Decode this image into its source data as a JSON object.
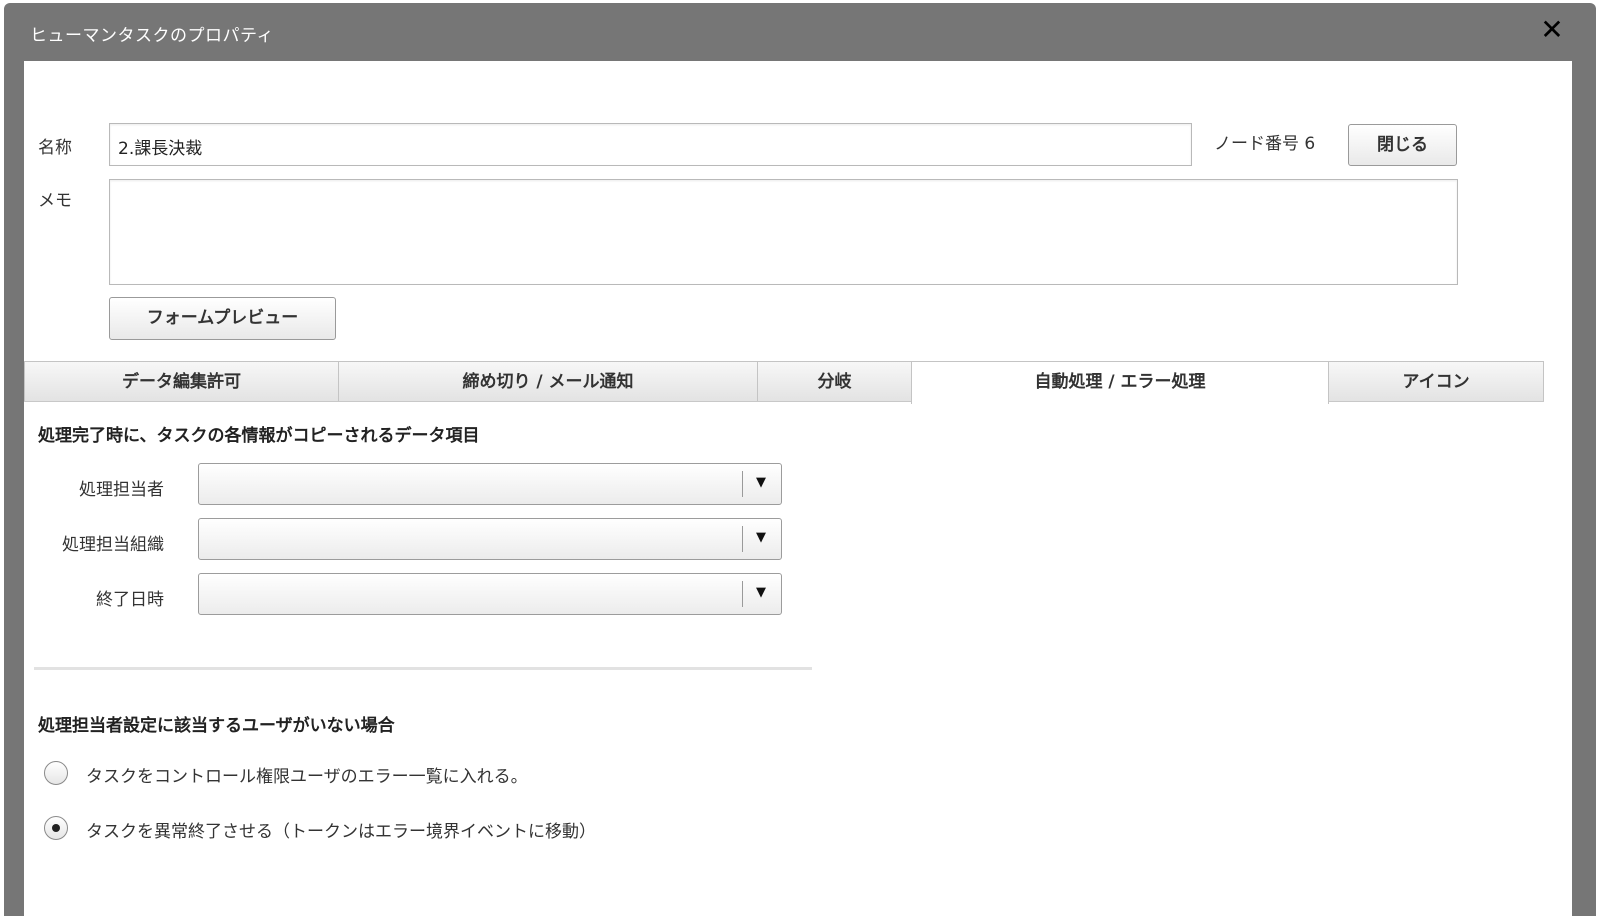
{
  "window": {
    "title": "ヒューマンタスクのプロパティ",
    "close_glyph": "✕"
  },
  "form": {
    "name_label": "名称",
    "name_value": "2.課長決裁",
    "node_number_label": "ノード番号 6",
    "close_button": "閉じる",
    "memo_label": "メモ",
    "memo_value": "",
    "preview_button": "フォームプレビュー"
  },
  "tabs": [
    {
      "label": "データ編集許可",
      "active": false
    },
    {
      "label": "締め切り / メール通知",
      "active": false
    },
    {
      "label": "分岐",
      "active": false
    },
    {
      "label": "自動処理 / エラー処理",
      "active": true
    },
    {
      "label": "アイコン",
      "active": false
    }
  ],
  "auto_section": {
    "title": "処理完了時に、タスクの各情報がコピーされるデータ項目",
    "fields": [
      {
        "label": "処理担当者",
        "value": ""
      },
      {
        "label": "処理担当組織",
        "value": ""
      },
      {
        "label": "終了日時",
        "value": ""
      }
    ],
    "dropdown_arrow": "▼"
  },
  "error_section": {
    "title": "処理担当者設定に該当するユーザがいない場合",
    "options": [
      {
        "label": "タスクをコントロール権限ユーザのエラー一覧に入れる。",
        "selected": false
      },
      {
        "label": "タスクを異常終了させる（トークンはエラー境界イベントに移動）",
        "selected": true
      }
    ]
  }
}
